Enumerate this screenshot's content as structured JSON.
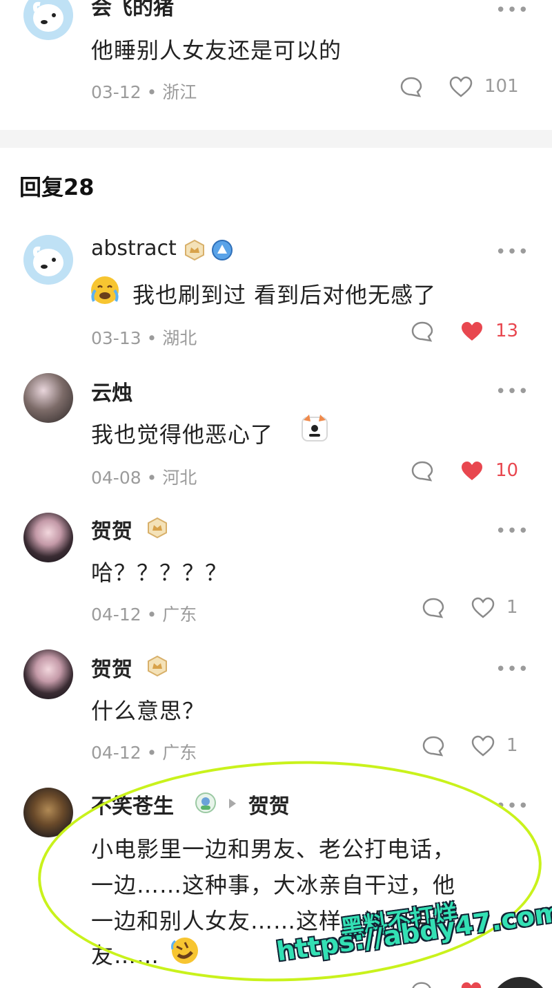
{
  "top_comment": {
    "name": "会飞的猪",
    "text": "他睡别人女友还是可以的",
    "meta": "03-12 • 浙江",
    "likes": "101"
  },
  "replies_header": "回复28",
  "replies": [
    {
      "name": "abstract",
      "text": "我也刷到过 看到后对他无感了",
      "meta": "03-13 • 湖北",
      "likes": "13",
      "liked": true
    },
    {
      "name": "云烛",
      "text": "我也觉得他恶心了",
      "meta": "04-08 • 河北",
      "likes": "10",
      "liked": true
    },
    {
      "name": "贺贺",
      "text": "哈？？？？？",
      "meta": "04-12 • 广东",
      "likes": "1",
      "liked": false
    },
    {
      "name": "贺贺",
      "text": "什么意思？",
      "meta": "04-12 • 广东",
      "likes": "1",
      "liked": false
    },
    {
      "name": "不笑苍生",
      "reply_to": "贺贺",
      "lines": [
        "小电影里一边和男友、老公打电话，",
        "一边……这种事，大冰亲自干过，他",
        "一边和别人女友……这样一边和男",
        "友……"
      ]
    }
  ],
  "more_label": "•••",
  "watermark": {
    "line1": "黑料不打烊",
    "line2": "https://abdy47.com"
  },
  "colors": {
    "like_red": "#e8474f",
    "meta_gray": "#9b9b9b",
    "highlight": "#c9f21c",
    "watermark": "#33e0b4"
  }
}
